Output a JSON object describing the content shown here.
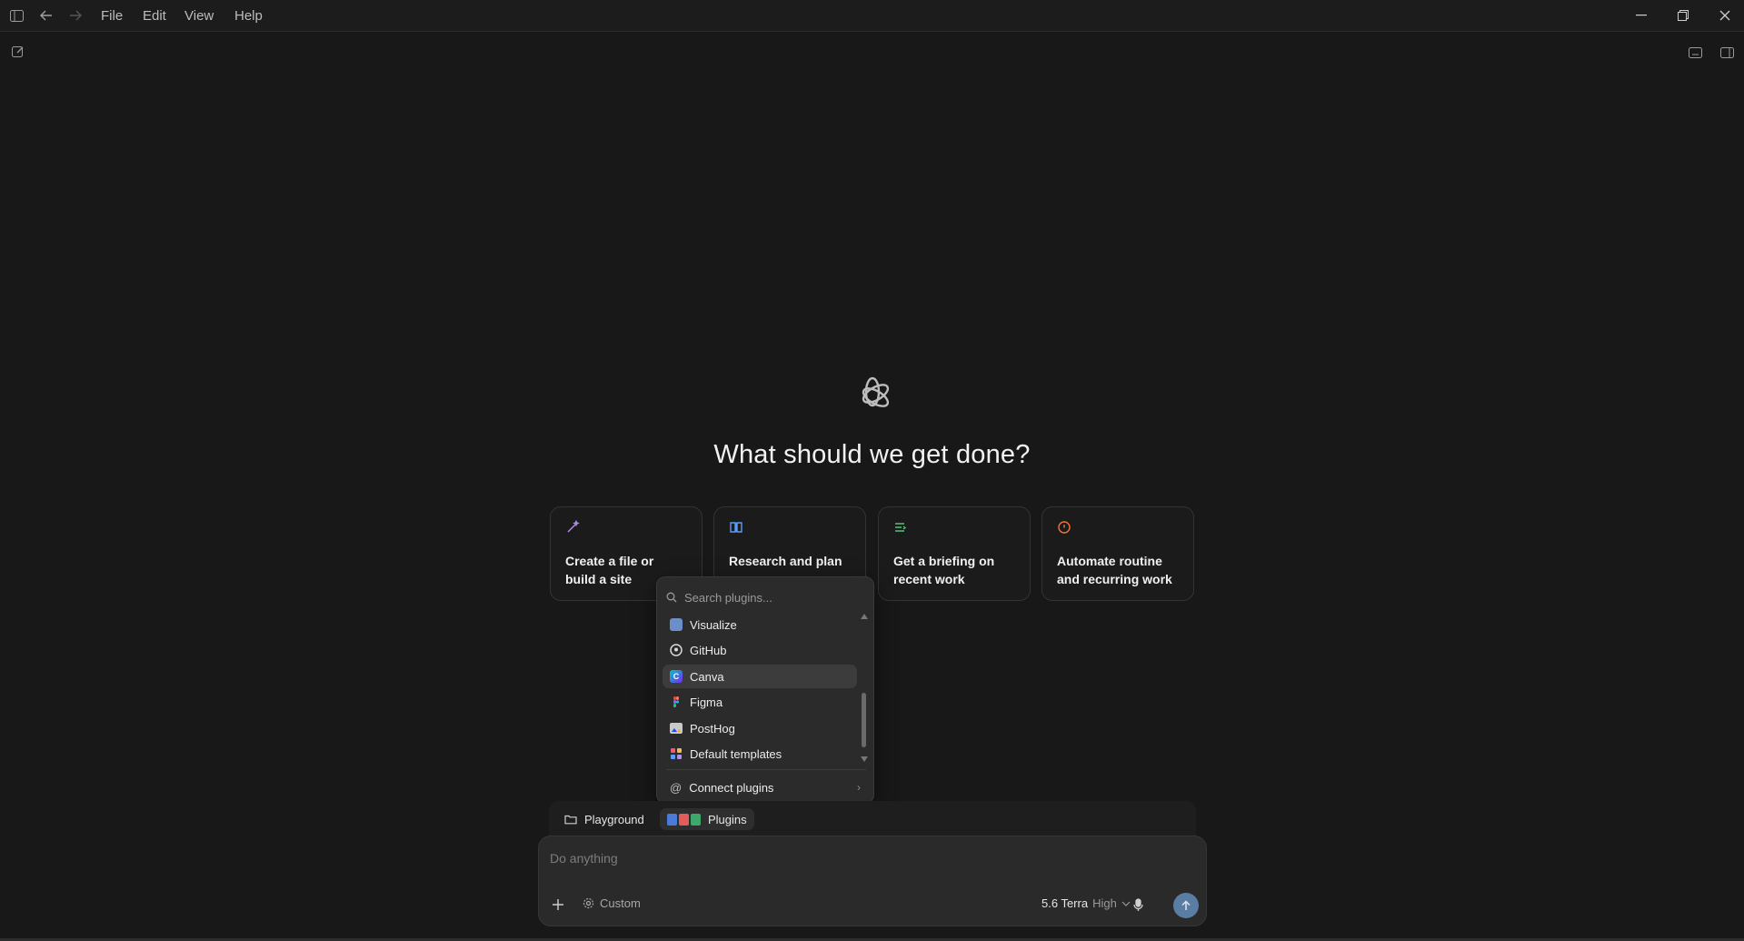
{
  "menu": {
    "file": "File",
    "edit": "Edit",
    "view": "View",
    "help": "Help"
  },
  "hero": {
    "title": "What should we get done?"
  },
  "cards": [
    {
      "label": "Create a file or build a site",
      "icon": "wand-icon",
      "color": "#b58cf0"
    },
    {
      "label": "Research and plan",
      "icon": "book-icon",
      "color": "#5b9cf5"
    },
    {
      "label": "Get a briefing on recent work",
      "icon": "list-icon",
      "color": "#4fc47a"
    },
    {
      "label": "Automate routine and recurring work",
      "icon": "alarm-icon",
      "color": "#f0733a"
    }
  ],
  "plugins_popover": {
    "search_placeholder": "Search plugins...",
    "items": [
      {
        "label": "Visualize",
        "icon": "visualize-icon"
      },
      {
        "label": "GitHub",
        "icon": "github-icon"
      },
      {
        "label": "Canva",
        "icon": "canva-icon",
        "selected": true
      },
      {
        "label": "Figma",
        "icon": "figma-icon"
      },
      {
        "label": "PostHog",
        "icon": "posthog-icon"
      },
      {
        "label": "Default templates",
        "icon": "templates-icon"
      }
    ],
    "connect_label": "Connect plugins"
  },
  "chips": {
    "playground": "Playground",
    "plugins": "Plugins"
  },
  "composer": {
    "placeholder": "Do anything",
    "mode": "Custom",
    "model": "5.6 Terra",
    "effort": "High"
  }
}
